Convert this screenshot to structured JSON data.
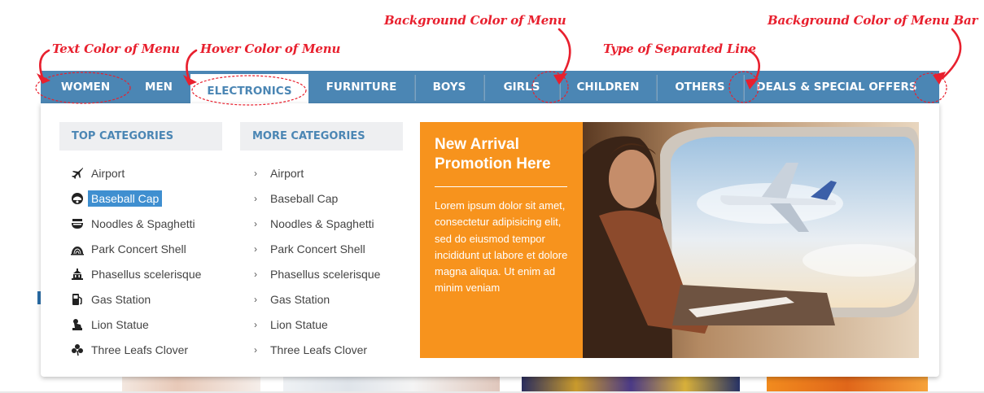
{
  "annotations": {
    "text_color": "Text Color of Menu",
    "hover_color": "Hover Color of Menu",
    "bg_color_menu": "Background Color of Menu",
    "separator": "Type of Separated Line",
    "bg_color_bar": "Background Color of Menu Bar"
  },
  "menu": {
    "items": [
      {
        "label": "WOMEN"
      },
      {
        "label": "MEN"
      },
      {
        "label": "ELECTRONICS",
        "active": true
      },
      {
        "label": "FURNITURE"
      },
      {
        "label": "BOYS"
      },
      {
        "label": "GIRLS"
      },
      {
        "label": "CHILDREN"
      },
      {
        "label": "OTHERS"
      },
      {
        "label": "DEALS & SPECIAL OFFERS"
      }
    ],
    "bar_color": "#4b86b4"
  },
  "top_categories": {
    "heading": "TOP CATEGORIES",
    "items": [
      {
        "label": "Airport",
        "icon": "plane-icon"
      },
      {
        "label": "Baseball Cap",
        "icon": "helmet-icon",
        "highlighted": true
      },
      {
        "label": "Noodles & Spaghetti",
        "icon": "bowl-icon"
      },
      {
        "label": "Park Concert Shell",
        "icon": "concert-shell-icon"
      },
      {
        "label": "Phasellus scelerisque",
        "icon": "building-icon"
      },
      {
        "label": "Gas Station",
        "icon": "gas-pump-icon"
      },
      {
        "label": "Lion Statue",
        "icon": "lion-statue-icon"
      },
      {
        "label": "Three Leafs Clover",
        "icon": "clover-icon"
      }
    ]
  },
  "more_categories": {
    "heading": "MORE CATEGORIES",
    "items": [
      {
        "label": "Airport"
      },
      {
        "label": "Baseball Cap"
      },
      {
        "label": "Noodles & Spaghetti"
      },
      {
        "label": "Park Concert Shell"
      },
      {
        "label": "Phasellus scelerisque"
      },
      {
        "label": "Gas Station"
      },
      {
        "label": "Lion Statue"
      },
      {
        "label": "Three Leafs Clover"
      }
    ]
  },
  "promo": {
    "title": "New Arrival Promotion Here",
    "text": "Lorem ipsum dolor sit amet, consectetur adipisicing elit, sed do eiusmod tempor incididunt ut labore et dolore magna aliqua. Ut enim ad minim veniam",
    "bg_color": "#f7931d"
  }
}
